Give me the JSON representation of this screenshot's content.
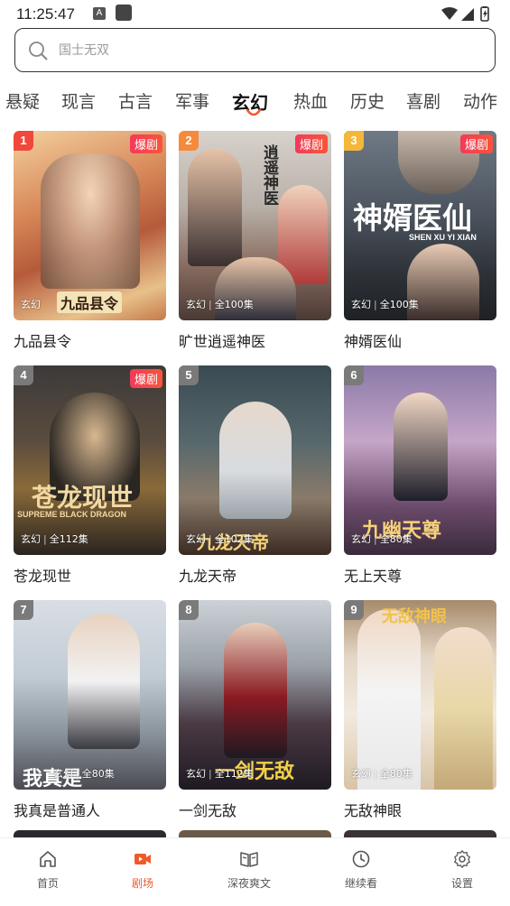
{
  "status_bar": {
    "time": "11:25:47",
    "badge": "A"
  },
  "search": {
    "placeholder": "国士无双"
  },
  "categories": [
    {
      "label": "悬疑",
      "active": false
    },
    {
      "label": "现言",
      "active": false
    },
    {
      "label": "古言",
      "active": false
    },
    {
      "label": "军事",
      "active": false
    },
    {
      "label": "玄幻",
      "active": true
    },
    {
      "label": "热血",
      "active": false
    },
    {
      "label": "历史",
      "active": false
    },
    {
      "label": "喜剧",
      "active": false
    },
    {
      "label": "动作",
      "active": false
    }
  ],
  "dramas": [
    {
      "rank": "1",
      "title": "九品县令",
      "genre": "玄幻",
      "episodes": "",
      "hot": "爆剧",
      "art_text": "九品县令"
    },
    {
      "rank": "2",
      "title": "旷世逍遥神医",
      "genre": "玄幻",
      "episodes": "全100集",
      "hot": "爆剧",
      "art_text": "逍遥神医"
    },
    {
      "rank": "3",
      "title": "神婿医仙",
      "genre": "玄幻",
      "episodes": "全100集",
      "hot": "爆剧",
      "art_text": "神婿医仙",
      "art_sub": "SHEN XU YI XIAN"
    },
    {
      "rank": "4",
      "title": "苍龙现世",
      "genre": "玄幻",
      "episodes": "全112集",
      "hot": "爆剧",
      "art_text": "苍龙现世",
      "art_sub": "SUPREME BLACK DRAGON"
    },
    {
      "rank": "5",
      "title": "九龙天帝",
      "genre": "玄幻",
      "episodes": "全102集",
      "hot": "",
      "art_text": "九龙天帝"
    },
    {
      "rank": "6",
      "title": "无上天尊",
      "genre": "玄幻",
      "episodes": "全80集",
      "hot": "",
      "art_text": "九幽天尊"
    },
    {
      "rank": "7",
      "title": "我真是普通人",
      "genre": "玄幻",
      "episodes": "全80集",
      "hot": "",
      "art_text": "我真是"
    },
    {
      "rank": "8",
      "title": "一剑无敌",
      "genre": "玄幻",
      "episodes": "全112集",
      "hot": "",
      "art_text": "一剑无敌"
    },
    {
      "rank": "9",
      "title": "无敌神眼",
      "genre": "玄幻",
      "episodes": "全80集",
      "hot": "",
      "art_text": "无敌神眼"
    }
  ],
  "rank_colors": [
    "#f0483a",
    "#f48a3a",
    "#f4b73a",
    "#7a7a7a",
    "#7a7a7a",
    "#7a7a7a",
    "#7a7a7a",
    "#7a7a7a",
    "#7a7a7a"
  ],
  "bottom_nav": [
    {
      "label": "首页",
      "icon": "home-icon",
      "active": false
    },
    {
      "label": "剧场",
      "icon": "video-icon",
      "active": true
    },
    {
      "label": "深夜爽文",
      "icon": "book-icon",
      "active": false
    },
    {
      "label": "继续看",
      "icon": "clock-icon",
      "active": false
    },
    {
      "label": "设置",
      "icon": "settings-icon",
      "active": false
    }
  ],
  "colors": {
    "accent": "#f05a2a",
    "hot_badge": "#f23a5a"
  }
}
